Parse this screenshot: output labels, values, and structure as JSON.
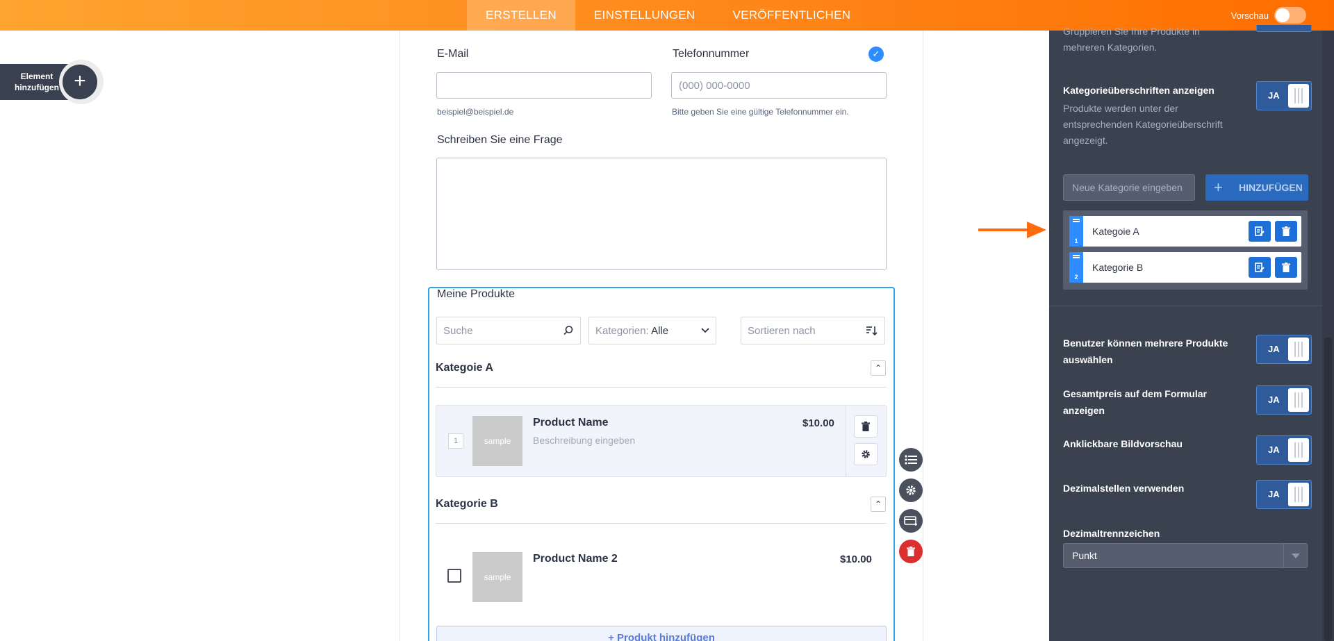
{
  "topbar": {
    "tabs": [
      "ERSTELLEN",
      "EINSTELLUNGEN",
      "VERÖFFENTLICHEN"
    ],
    "active_tab": "ERSTELLEN",
    "preview_label": "Vorschau",
    "preview_on": false,
    "gradient": [
      "#ffa42e",
      "#ff6d00"
    ]
  },
  "add_element": {
    "label": "Element hinzufügen",
    "icon": "plus-icon"
  },
  "form": {
    "email": {
      "label": "E-Mail",
      "value": "",
      "sublabel": "beispiel@beispiel.de"
    },
    "phone": {
      "label": "Telefonnummer",
      "placeholder": "(000) 000-0000",
      "sublabel": "Bitte geben Sie eine gültige Telefonnummer ein."
    },
    "question": {
      "label": "Schreiben Sie eine Frage",
      "value": ""
    },
    "products": {
      "title": "Meine Produkte",
      "search_placeholder": "Suche",
      "categories_label": "Kategorien:",
      "categories_value": "Alle",
      "sort_label": "Sortieren nach",
      "categories": [
        {
          "name": "Kategoie A",
          "products": [
            {
              "name": "Product Name",
              "price": "$10.00",
              "description": "Beschreibung eingeben",
              "quantity": "1",
              "image": "sample"
            }
          ]
        },
        {
          "name": "Kategorie B",
          "products": [
            {
              "name": "Product Name 2",
              "price": "$10.00",
              "image": "sample",
              "checked": false
            }
          ]
        }
      ],
      "add_button": "+ Produkt hinzufügen"
    }
  },
  "panel": {
    "top_fragment": "Gruppieren Sie Ihre Produkte in mehreren Kategorien.",
    "show_headings": {
      "title": "Kategorieüberschriften anzeigen",
      "desc": "Produkte werden unter der entsprechenden Kategorieüberschrift angezeigt.",
      "toggle": "JA"
    },
    "new_category_placeholder": "Neue Kategorie eingeben",
    "add_category_button": "HINZUFÜGEN",
    "category_list": [
      {
        "index": "1",
        "name": "Kategoie A"
      },
      {
        "index": "2",
        "name": "Kategorie B"
      }
    ],
    "options": [
      {
        "title": "Benutzer können mehrere Produkte auswählen",
        "toggle": "JA"
      },
      {
        "title": "Gesamtpreis auf dem Formular anzeigen",
        "toggle": "JA"
      },
      {
        "title": "Anklickbare Bildvorschau",
        "toggle": "JA"
      },
      {
        "title": "Dezimalstellen verwenden",
        "toggle": "JA"
      }
    ],
    "decimal_separator": {
      "label": "Dezimaltrennzeichen",
      "value": "Punkt"
    }
  },
  "colors": {
    "accent": "#ff7a00",
    "panel_bg": "#3a414f",
    "selection": "#2da5e6",
    "toggle_on": "#2f5b9a"
  }
}
